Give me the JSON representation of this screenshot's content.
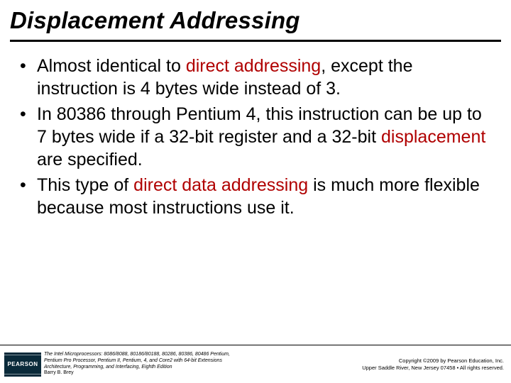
{
  "title": "Displacement Addressing",
  "bullets": {
    "b1a": "Almost identical to ",
    "b1hl": "direct addressing",
    "b1b": ", except the instruction is 4 bytes wide instead of 3.",
    "b2a": "In 80386 through Pentium 4, this instruction can be up to 7 bytes wide if a 32-bit register and a 32-bit ",
    "b2hl": "displacement",
    "b2b": " are specified.",
    "b3a": "This type of ",
    "b3hl": "direct data addressing",
    "b3b": " is much more flexible because most instructions use it."
  },
  "footer": {
    "logo": "PEARSON",
    "book1": "The Intel Microprocessors: 8086/8088, 80186/80188, 80286, 80386, 80486 Pentium,",
    "book2": "Pentium Pro Processor, Pentium II, Pentium, 4, and Core2 with 64-bit Extensions",
    "book3": "Architecture, Programming, and Interfacing, Eighth Edition",
    "author": "Barry B. Brey",
    "copy1": "Copyright ©2009 by Pearson Education, Inc.",
    "copy2": "Upper Saddle River, New Jersey 07458 • All rights reserved."
  }
}
